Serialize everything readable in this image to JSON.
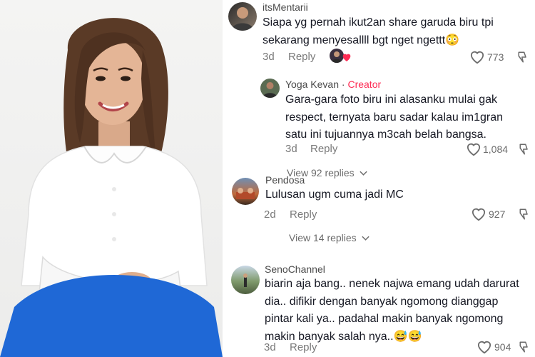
{
  "comments": [
    {
      "username": "itsMentarii",
      "text_line1": "Siapa yg pernah ikut2an share garuda biru tpi",
      "text_line2": "sekarang menyesallll bgt nget ngettt😳",
      "age": "3d",
      "reply_label": "Reply",
      "likes": "773"
    },
    {
      "username": "Yoga Kevan",
      "separator": "·",
      "badge": "Creator",
      "text_line1": "Gara-gara foto biru ini alasanku mulai gak",
      "text_line2": "respect, ternyata baru sadar kalau im1gran",
      "text_line3": "satu ini tujuannya m3cah belah bangsa.",
      "age": "3d",
      "reply_label": "Reply",
      "likes": "1,084"
    },
    {
      "username": "Pendosa",
      "text_line1": "Lulusan ugm cuma jadi MC",
      "age": "2d",
      "reply_label": "Reply",
      "likes": "927"
    },
    {
      "username": "SenoChannel",
      "text_line1": "biarin aja bang.. nenek najwa emang udah darurat",
      "text_line2": "dia.. difikir dengan banyak ngomong dianggap",
      "text_line3": "pintar kali ya.. padahal makin banyak ngomong",
      "text_line4": "makin banyak salah nya..😅😅",
      "age": "3d",
      "reply_label": "Reply",
      "likes": "904"
    }
  ],
  "view_replies": [
    {
      "label": "View 92 replies"
    },
    {
      "label": "View 14 replies"
    }
  ],
  "colors": {
    "creator_badge": "#fe2c55",
    "blouse": "#ffffff",
    "skirt": "#1f68d6"
  }
}
